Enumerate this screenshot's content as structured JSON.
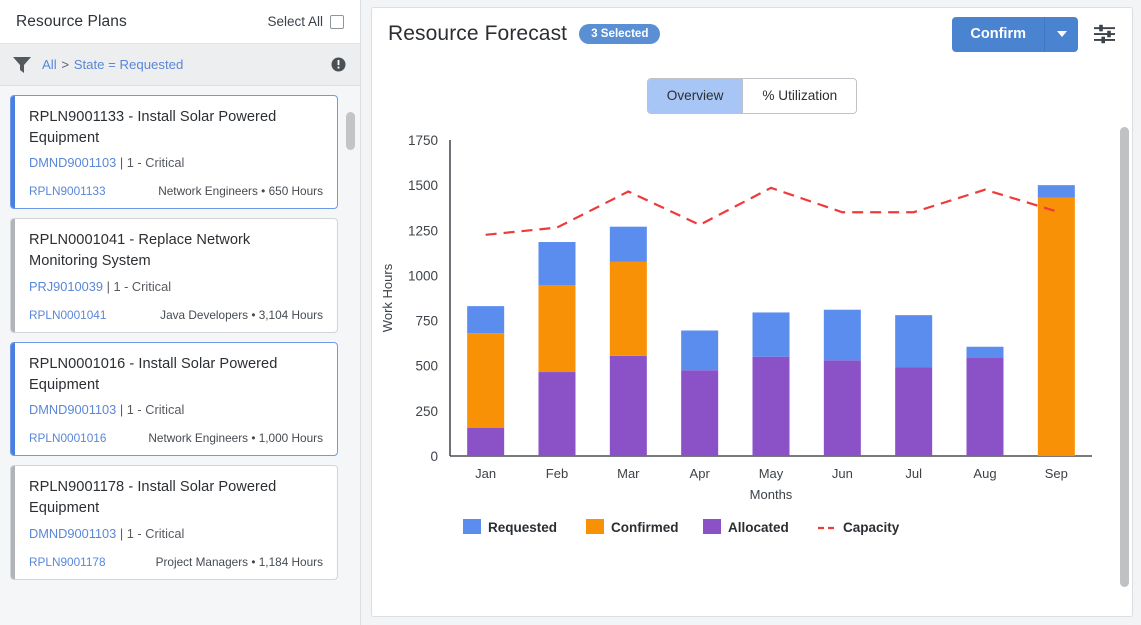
{
  "left_panel": {
    "title": "Resource Plans",
    "select_all_label": "Select All",
    "filter": {
      "scope": "All",
      "separator": ">",
      "expression": "State = Requested"
    },
    "cards": [
      {
        "title": "RPLN9001133 - Install Solar Powered Equipment",
        "parent_id": "DMND9001103",
        "priority": "| 1 - Critical",
        "plan_id": "RPLN9001133",
        "resource_summary": "Network Engineers • 650 Hours",
        "selected": true
      },
      {
        "title": "RPLN0001041 - Replace Network Monitoring System",
        "parent_id": "PRJ9010039",
        "priority": "| 1 - Critical",
        "plan_id": "RPLN0001041",
        "resource_summary": "Java Developers • 3,104 Hours",
        "selected": false
      },
      {
        "title": "RPLN0001016 - Install Solar Powered Equipment",
        "parent_id": "DMND9001103",
        "priority": "| 1 - Critical",
        "plan_id": "RPLN0001016",
        "resource_summary": "Network Engineers • 1,000 Hours",
        "selected": true
      },
      {
        "title": "RPLN9001178 - Install Solar Powered Equipment",
        "parent_id": "DMND9001103",
        "priority": "| 1 - Critical",
        "plan_id": "RPLN9001178",
        "resource_summary": "Project Managers • 1,184 Hours",
        "selected": false
      }
    ]
  },
  "right_panel": {
    "title": "Resource Forecast",
    "selected_badge": "3 Selected",
    "confirm_label": "Confirm",
    "tabs": [
      {
        "label": "Overview",
        "active": true
      },
      {
        "label": "% Utilization",
        "active": false
      }
    ]
  },
  "chart_data": {
    "type": "bar",
    "stacked": true,
    "title": "",
    "xlabel": "Months",
    "ylabel": "Work Hours",
    "categories": [
      "Jan",
      "Feb",
      "Mar",
      "Apr",
      "May",
      "Jun",
      "Jul",
      "Aug",
      "Sep"
    ],
    "yticks": [
      0,
      250,
      500,
      750,
      1000,
      1250,
      1500,
      1750
    ],
    "ylim": [
      0,
      1750
    ],
    "grid": false,
    "legend_position": "bottom",
    "series": [
      {
        "name": "Allocated",
        "color": "#8b52c8",
        "type": "bar",
        "values": [
          155,
          465,
          555,
          475,
          550,
          530,
          490,
          545,
          0
        ]
      },
      {
        "name": "Confirmed",
        "color": "#f99106",
        "type": "bar",
        "values": [
          525,
          480,
          520,
          0,
          0,
          0,
          0,
          0,
          1430
        ]
      },
      {
        "name": "Requested",
        "color": "#5b8def",
        "type": "bar",
        "values": [
          150,
          240,
          195,
          220,
          245,
          280,
          290,
          60,
          70
        ]
      },
      {
        "name": "Capacity",
        "color": "#ef3a3a",
        "type": "line",
        "dashed": true,
        "values": [
          1225,
          1265,
          1465,
          1280,
          1485,
          1350,
          1350,
          1475,
          1355
        ]
      }
    ],
    "legend": [
      "Requested",
      "Confirmed",
      "Allocated",
      "Capacity"
    ]
  }
}
